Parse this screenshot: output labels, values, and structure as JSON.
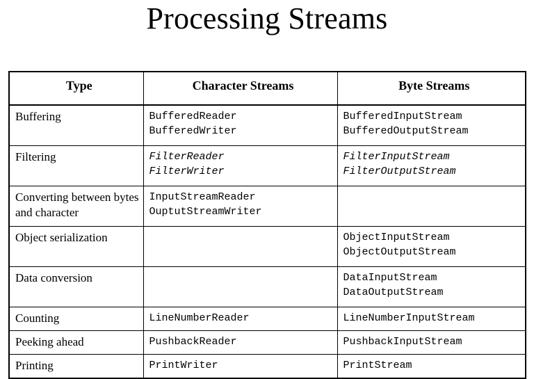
{
  "title": "Processing Streams",
  "table": {
    "columns": [
      {
        "key": "type",
        "label": "Type"
      },
      {
        "key": "char",
        "label": "Character Streams"
      },
      {
        "key": "byte",
        "label": "Byte Streams"
      }
    ],
    "rows": [
      {
        "type": "Buffering",
        "char": "BufferedReader\nBufferedWriter",
        "byte": "BufferedInputStream\nBufferedOutputStream",
        "style": "normal",
        "lines": 2
      },
      {
        "type": "Filtering",
        "char": "FilterReader\nFilterWriter",
        "byte": "FilterInputStream\nFilterOutputStream",
        "style": "italic",
        "lines": 2
      },
      {
        "type": "Converting between bytes and character",
        "char": "InputStreamReader\nOuptutStreamWriter",
        "byte": "",
        "style": "normal",
        "lines": 2
      },
      {
        "type": "Object serialization",
        "char": "",
        "byte": "ObjectInputStream\nObjectOutputStream",
        "style": "normal",
        "lines": 2
      },
      {
        "type": "Data conversion",
        "char": "",
        "byte": "DataInputStream\nDataOutputStream",
        "style": "normal",
        "lines": 2
      },
      {
        "type": "Counting",
        "char": "LineNumberReader",
        "byte": "LineNumberInputStream",
        "style": "normal",
        "lines": 1
      },
      {
        "type": "Peeking ahead",
        "char": "PushbackReader",
        "byte": "PushbackInputStream",
        "style": "normal",
        "lines": 1
      },
      {
        "type": "Printing",
        "char": "PrintWriter",
        "byte": "PrintStream",
        "style": "normal",
        "lines": 1
      }
    ]
  },
  "colors": {
    "background": "#ffffff",
    "text": "#000000",
    "border": "#000000"
  }
}
